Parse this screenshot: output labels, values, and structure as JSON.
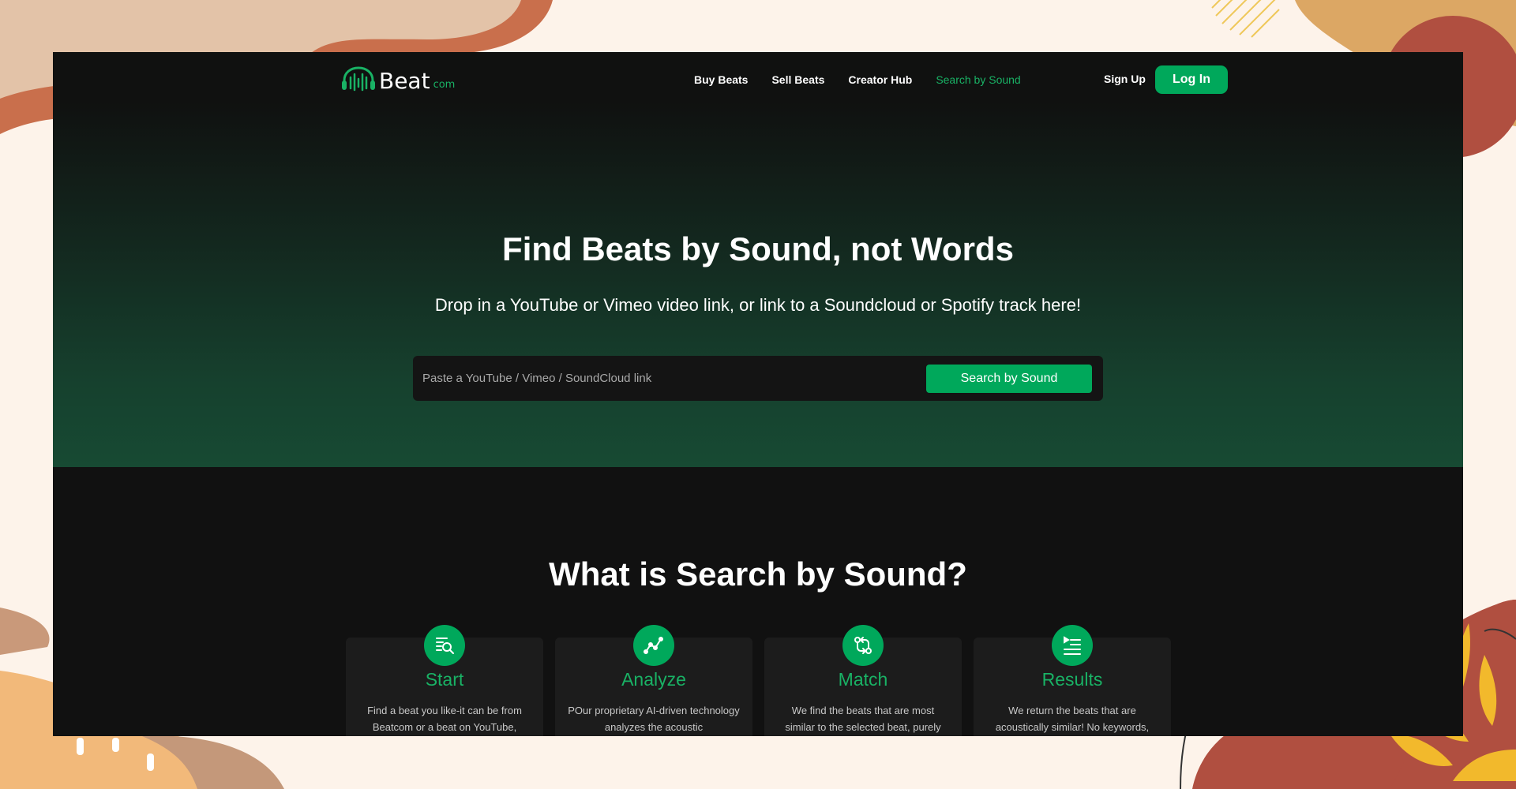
{
  "logo": {
    "name": "Beat",
    "suffix": "com"
  },
  "nav": {
    "links": [
      {
        "label": "Buy Beats",
        "active": false
      },
      {
        "label": "Sell Beats",
        "active": false
      },
      {
        "label": "Creator Hub",
        "active": false
      },
      {
        "label": "Search by Sound",
        "active": true
      }
    ],
    "signup_label": "Sign Up",
    "login_label": "Log In"
  },
  "hero": {
    "title": "Find Beats by Sound, not Words",
    "subtitle": "Drop in a YouTube or Vimeo video link, or link to a Soundcloud or Spotify track here!",
    "search_placeholder": "Paste a YouTube / Vimeo / SoundCloud link",
    "search_button": "Search by Sound"
  },
  "section": {
    "title": "What is Search by Sound?",
    "cards": [
      {
        "icon": "search-list-icon",
        "title": "Start",
        "desc": "Find a beat you like-it can be from Beatcom or a beat on YouTube,"
      },
      {
        "icon": "analyze-graph-icon",
        "title": "Analyze",
        "desc": "POur proprietary AI-driven technology analyzes the acoustic"
      },
      {
        "icon": "match-arrows-icon",
        "title": "Match",
        "desc": "We find the beats that are most similar to the selected beat, purely"
      },
      {
        "icon": "results-list-icon",
        "title": "Results",
        "desc": "We return the beats that are acoustically similar! No keywords,"
      }
    ]
  },
  "colors": {
    "accent": "#00a85b",
    "accent_text": "#19b265",
    "background": "#111111",
    "page_bg": "#fdf3ea"
  }
}
